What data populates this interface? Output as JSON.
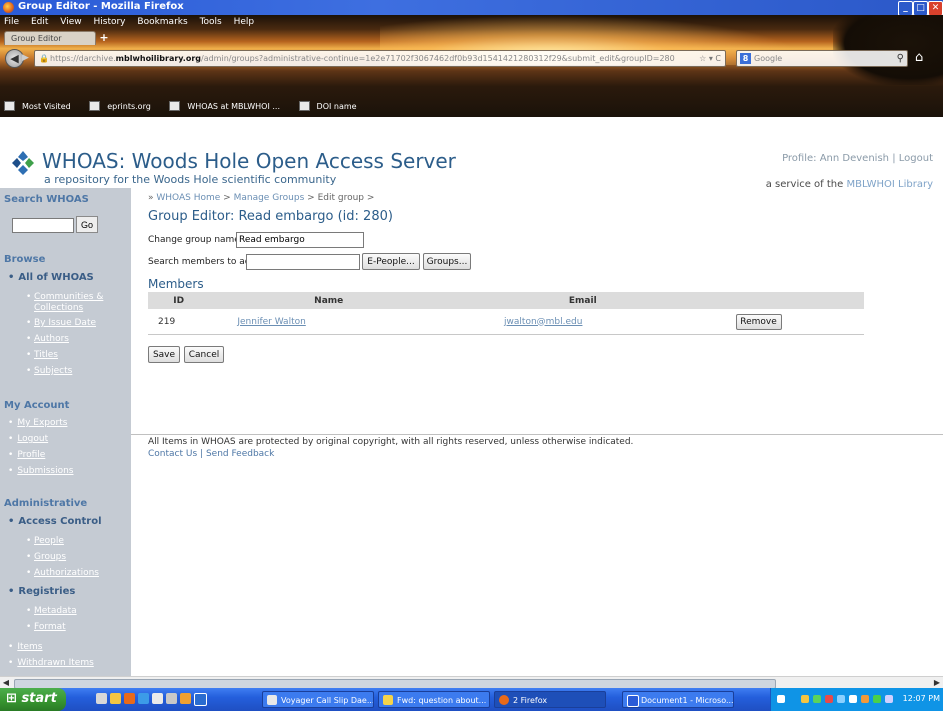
{
  "window": {
    "title": "Group Editor - Mozilla Firefox",
    "controls": [
      "_",
      "□",
      "✕"
    ]
  },
  "browser": {
    "menu": [
      "File",
      "Edit",
      "View",
      "History",
      "Bookmarks",
      "Tools",
      "Help"
    ],
    "tab_label": "Group Editor",
    "new_tab": "+",
    "url_prefix": "https://darchive.",
    "url_domain": "mblwhoilibrary.org",
    "url_rest": "/admin/groups?administrative-continue=1e2e71702f3067462df0b93d1541421280312f29&submit_edit&groupID=280",
    "search_engine": "Google",
    "bookmarks": [
      "Most Visited",
      "eprints.org",
      "WHOAS at MBLWHOI ...",
      "DOI name"
    ]
  },
  "header": {
    "site_title": "WHOAS: Woods Hole Open Access Server",
    "tagline": "a repository for the Woods Hole scientific community",
    "profile_label": "Profile: Ann Devenish",
    "logout": "Logout",
    "separator": "|",
    "service_prefix": "a service of the",
    "service_link": "MBLWHOI Library"
  },
  "sidebar": {
    "search_heading": "Search WHOAS",
    "search_go": "Go",
    "browse_heading": "Browse",
    "all_of_whoas": "All of WHOAS",
    "browse_links": [
      "Communities & Collections",
      "By Issue Date",
      "Authors",
      "Titles",
      "Subjects"
    ],
    "account_heading": "My Account",
    "account_links": [
      "My Exports",
      "Logout",
      "Profile",
      "Submissions"
    ],
    "admin_heading": "Administrative",
    "access_control": "Access Control",
    "access_links": [
      "People",
      "Groups",
      "Authorizations"
    ],
    "registries": "Registries",
    "registry_links": [
      "Metadata",
      "Format"
    ],
    "admin_links": [
      "Items",
      "Withdrawn Items"
    ]
  },
  "main": {
    "breadcrumb": {
      "prefix": "»",
      "home": "WHOAS Home",
      "manage": "Manage Groups",
      "current": "Edit group",
      "sep": ">"
    },
    "page_title": "Group Editor: Read embargo (id: 280)",
    "change_name_label": "Change group name:",
    "group_name_value": "Read embargo",
    "search_members_label": "Search members to add:",
    "search_members_value": "",
    "epeople_button": "E-People...",
    "groups_button": "Groups...",
    "members_heading": "Members",
    "table": {
      "headers": [
        "ID",
        "Name",
        "Email",
        ""
      ],
      "rows": [
        {
          "id": "219",
          "name": "Jennifer Walton",
          "email": "jwalton@mbl.edu",
          "action": "Remove"
        }
      ]
    },
    "save_button": "Save",
    "cancel_button": "Cancel"
  },
  "footer": {
    "notice": "All Items in WHOAS are protected by original copyright, with all rights reserved, unless otherwise indicated.",
    "contact": "Contact Us",
    "sep": "|",
    "feedback": "Send Feedback"
  },
  "taskbar": {
    "start": "start",
    "tasks": [
      "Voyager Call Slip Dae...",
      "Fwd: question about...",
      "2 Firefox",
      "Document1 - Microso..."
    ],
    "clock": "12:07 PM"
  },
  "colors": {
    "title_blue": "#2c5d8a",
    "link_blue": "#6b8fb4",
    "sidebar_bg": "#c5cbd3",
    "taskbar_blue": "#245fdc",
    "start_green": "#36932f"
  }
}
